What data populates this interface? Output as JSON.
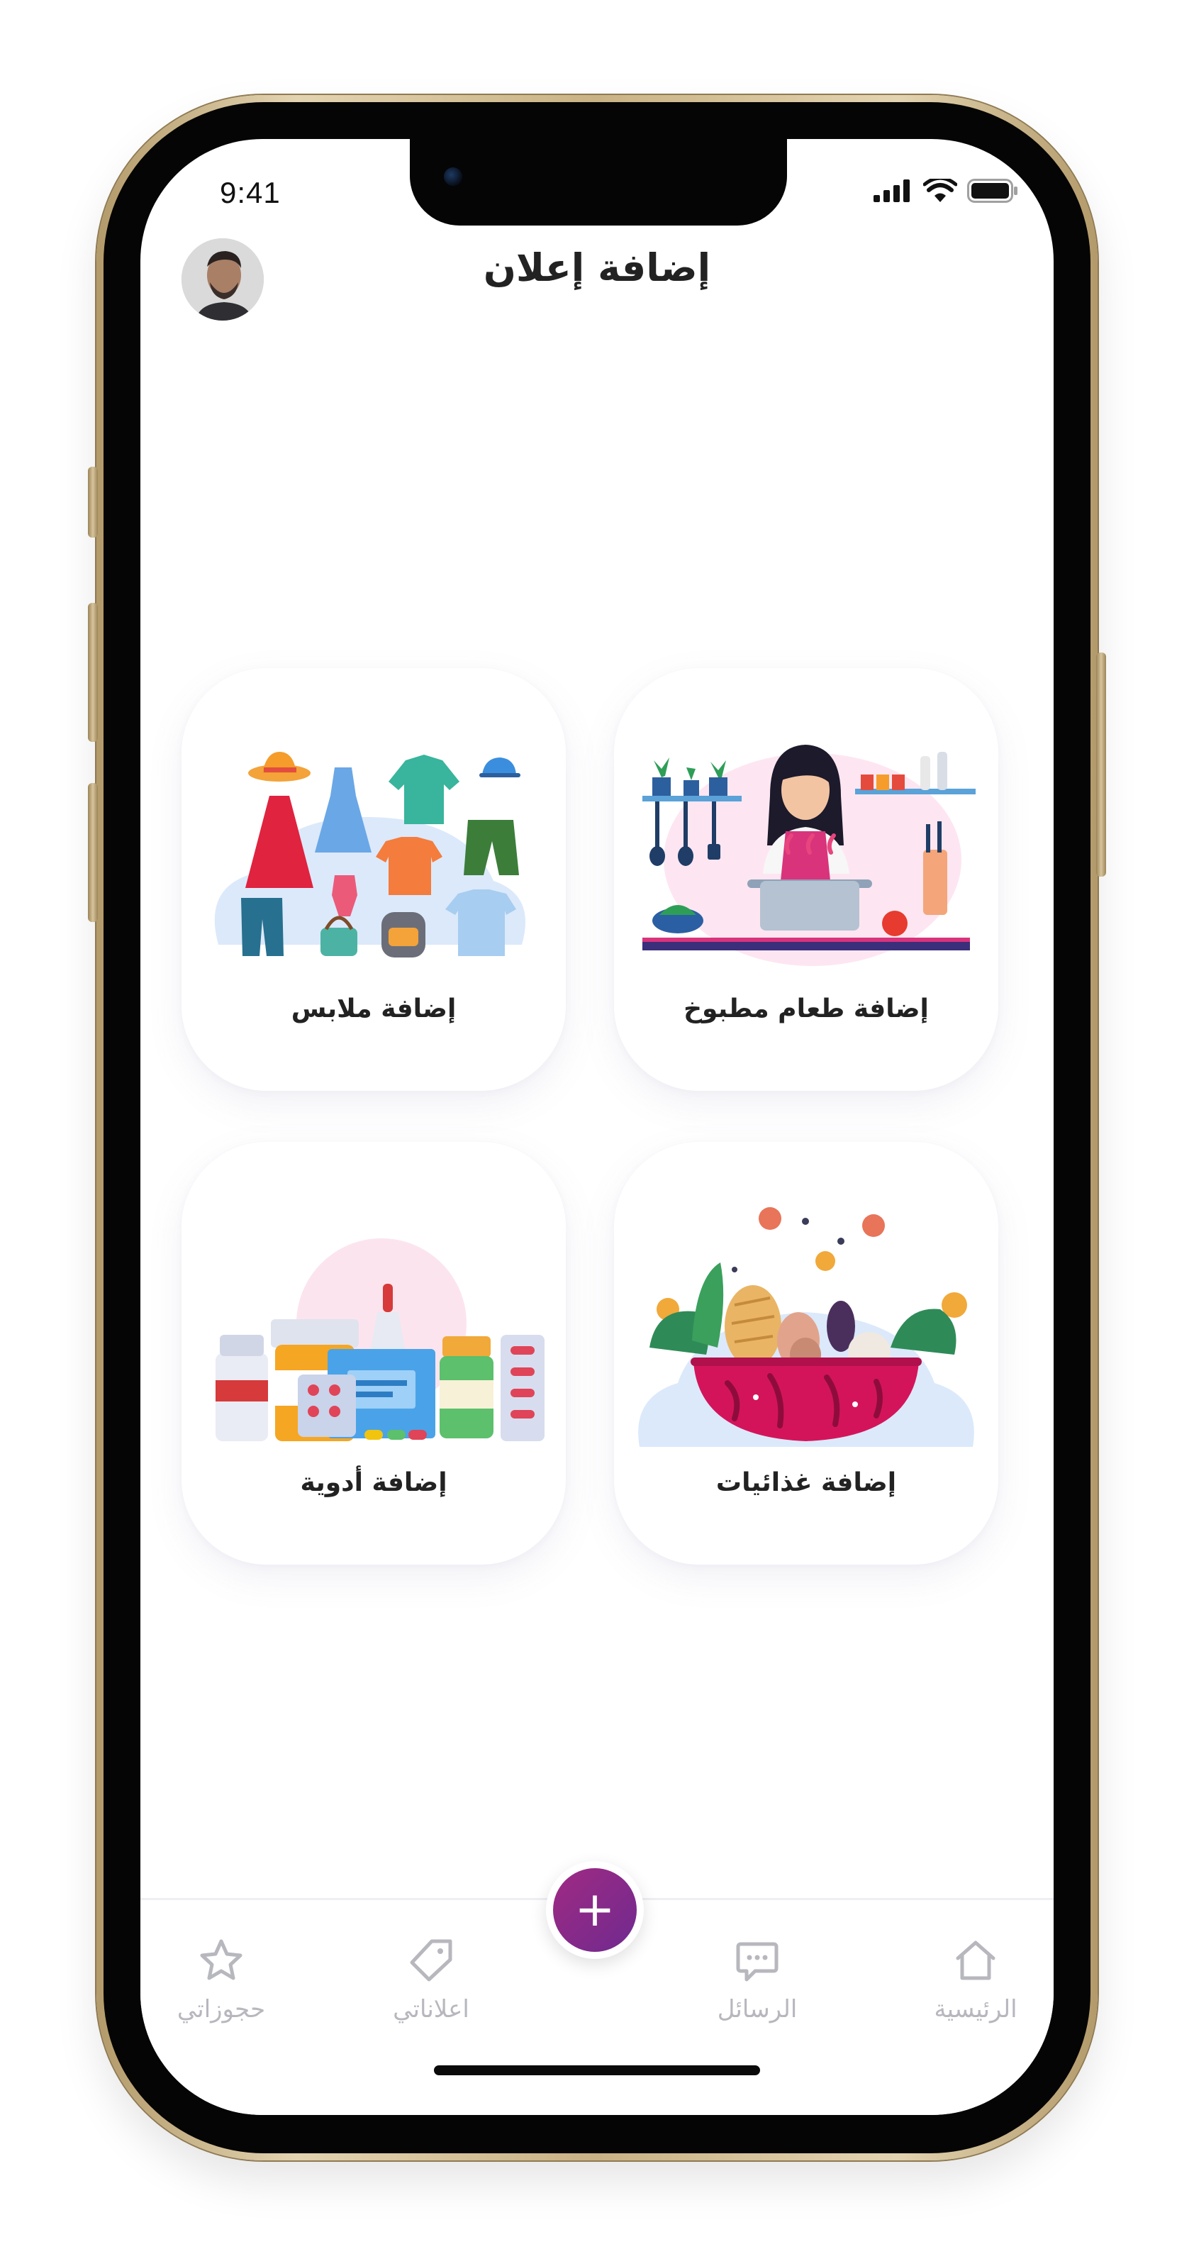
{
  "status_bar": {
    "time": "9:41"
  },
  "header": {
    "title": "إضافة إعلان"
  },
  "cards": [
    {
      "label": "إضافة طعام مطبوخ",
      "icon": "cooking-illustration"
    },
    {
      "label": "إضافة ملابس",
      "icon": "clothes-illustration"
    },
    {
      "label": "إضافة غذائيات",
      "icon": "groceries-bowl-illustration"
    },
    {
      "label": "إضافة أدوية",
      "icon": "medicine-illustration"
    }
  ],
  "bottom_nav": {
    "items": [
      {
        "label": "الرئيسية",
        "icon": "home-icon"
      },
      {
        "label": "الرسائل",
        "icon": "chat-icon"
      },
      {
        "label": "اعلاناتي",
        "icon": "tag-icon"
      },
      {
        "label": "حجوزاتي",
        "icon": "star-icon"
      }
    ],
    "fab_symbol": "+"
  },
  "colors": {
    "accent": "#8e2a87",
    "text": "#222222",
    "nav_inactive": "#b7b7be",
    "bowl": "#d4145a",
    "soft_blue": "#dbe9fb"
  }
}
